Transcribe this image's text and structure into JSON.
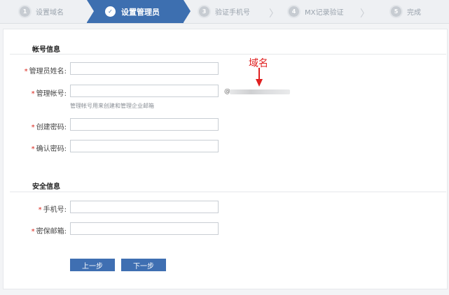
{
  "steps": [
    {
      "num": "1",
      "label": "设置域名"
    },
    {
      "num": "✓",
      "label": "设置管理员"
    },
    {
      "num": "3",
      "label": "验证手机号"
    },
    {
      "num": "4",
      "label": "MX记录验证"
    },
    {
      "num": "5",
      "label": "完成"
    }
  ],
  "account": {
    "title": "帐号信息",
    "admin_name_label": "管理员姓名:",
    "admin_account_label": "管理帐号:",
    "account_hint": "管理帐号用来创建和管理企业邮箱",
    "domain_at": "@",
    "domain_annotation": "域名",
    "password_label": "创建密码:",
    "confirm_label": "确认密码:"
  },
  "security": {
    "title": "安全信息",
    "phone_label": "手机号:",
    "email_label": "密保邮箱:"
  },
  "required_mark": "*",
  "buttons": {
    "prev": "上一步",
    "next": "下一步"
  },
  "colors": {
    "accent": "#3d6fb0",
    "required": "#d9261c",
    "annotation": "#e02020"
  }
}
